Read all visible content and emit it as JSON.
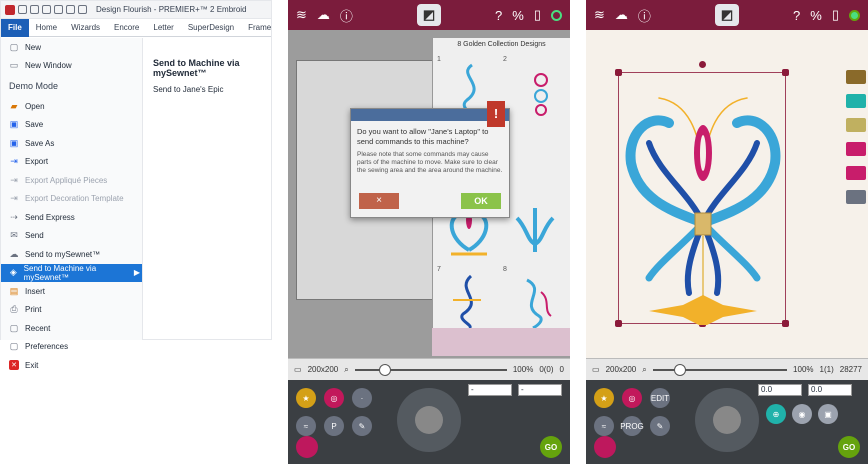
{
  "panel1": {
    "title": "Design Flourish - PREMIER+™ 2 Embroid",
    "ribbon_tabs": [
      "File",
      "Home",
      "Wizards",
      "Encore",
      "Letter",
      "SuperDesign",
      "Frame"
    ],
    "menu": [
      {
        "label": "New",
        "icon": "new-doc-icon"
      },
      {
        "label": "New Window",
        "icon": "window-icon"
      },
      {
        "label": "Demo Mode",
        "type": "section"
      },
      {
        "label": "Open",
        "icon": "folder-icon"
      },
      {
        "label": "Save",
        "icon": "save-icon"
      },
      {
        "label": "Save As",
        "icon": "save-as-icon"
      },
      {
        "label": "Export",
        "icon": "export-icon"
      },
      {
        "label": "Export Appliqué Pieces",
        "icon": "export-icon",
        "disabled": true
      },
      {
        "label": "Export Decoration Template",
        "icon": "export-icon",
        "disabled": true
      },
      {
        "label": "Send Express",
        "icon": "send-express-icon"
      },
      {
        "label": "Send",
        "icon": "send-icon"
      },
      {
        "label": "Send to mySewnet™",
        "icon": "cloud-icon"
      },
      {
        "label": "Send to Machine via mySewnet™",
        "icon": "machine-icon",
        "selected": true
      },
      {
        "label": "Insert",
        "icon": "insert-icon"
      },
      {
        "label": "Print",
        "icon": "print-icon"
      },
      {
        "label": "Recent",
        "icon": "recent-icon"
      },
      {
        "label": "Preferences",
        "icon": "preferences-icon"
      },
      {
        "label": "Exit",
        "icon": "exit-icon"
      }
    ],
    "submenu_heading": "Send to Machine via mySewnet™",
    "submenu_item": "Send to Jane's Epic"
  },
  "panel2": {
    "gallery_title": "8 Golden Collection Designs",
    "cell_numbers": [
      "1",
      "2",
      "3",
      "4",
      "5",
      "6",
      "7",
      "8"
    ],
    "dialog_question": "Do you want to allow \"Jane's Laptop\" to send commands to this machine?",
    "dialog_note": "Please note that some commands may cause parts of the machine to move. Make sure to clear the sewing area and the area around the machine.",
    "ok_label": "OK",
    "cancel_label": "×",
    "hoop_size": "200x200",
    "zoom": "100%",
    "stitch_count": "0(0)",
    "stitches": "0",
    "rotate_value": "-",
    "scale_value": "-"
  },
  "panel3": {
    "hoop_size": "200x200",
    "zoom": "100%",
    "stitch_count": "1(1)",
    "stitches": "28277",
    "position_value": "0.0",
    "angle_value": "0.0",
    "go_label": "GO",
    "edit_label": "EDIT",
    "prog_label": "PROG"
  },
  "colors": {
    "accent": "#7b1c3c",
    "file_tab": "#1c5fb7",
    "selected_menu": "#1c75d6",
    "ok_green": "#8bc34a",
    "cancel_red": "#c0634a",
    "motif_blue": "#3aa6d8",
    "motif_dark_blue": "#1f4fa8",
    "motif_gold": "#f2b12a",
    "motif_magenta": "#c81d6b"
  }
}
